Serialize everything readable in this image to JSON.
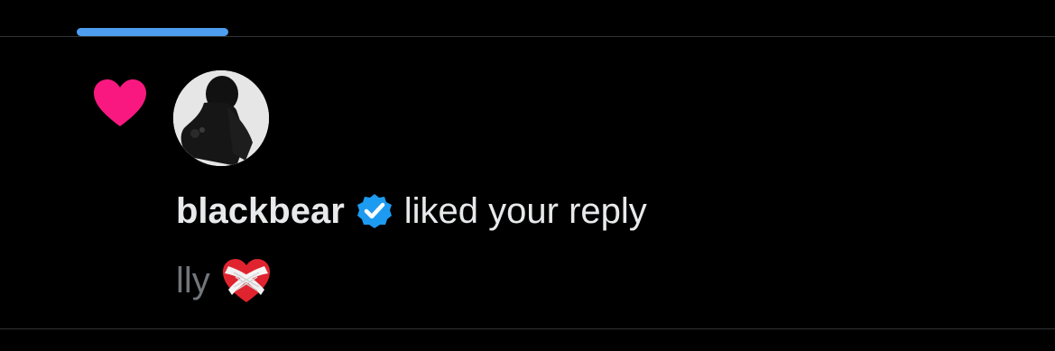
{
  "notification": {
    "type_icon": "heart-icon",
    "type_icon_color": "#f91880",
    "avatar_icon": "user-avatar",
    "username": "blackbear",
    "verified_icon": "verified-badge-icon",
    "verified_color": "#1d9bf0",
    "action_text": "liked your reply",
    "reply_text": "lly",
    "reply_emoji_icon": "mending-heart-icon"
  },
  "tabs": {
    "active_indicator_color": "#4d9ef0"
  }
}
